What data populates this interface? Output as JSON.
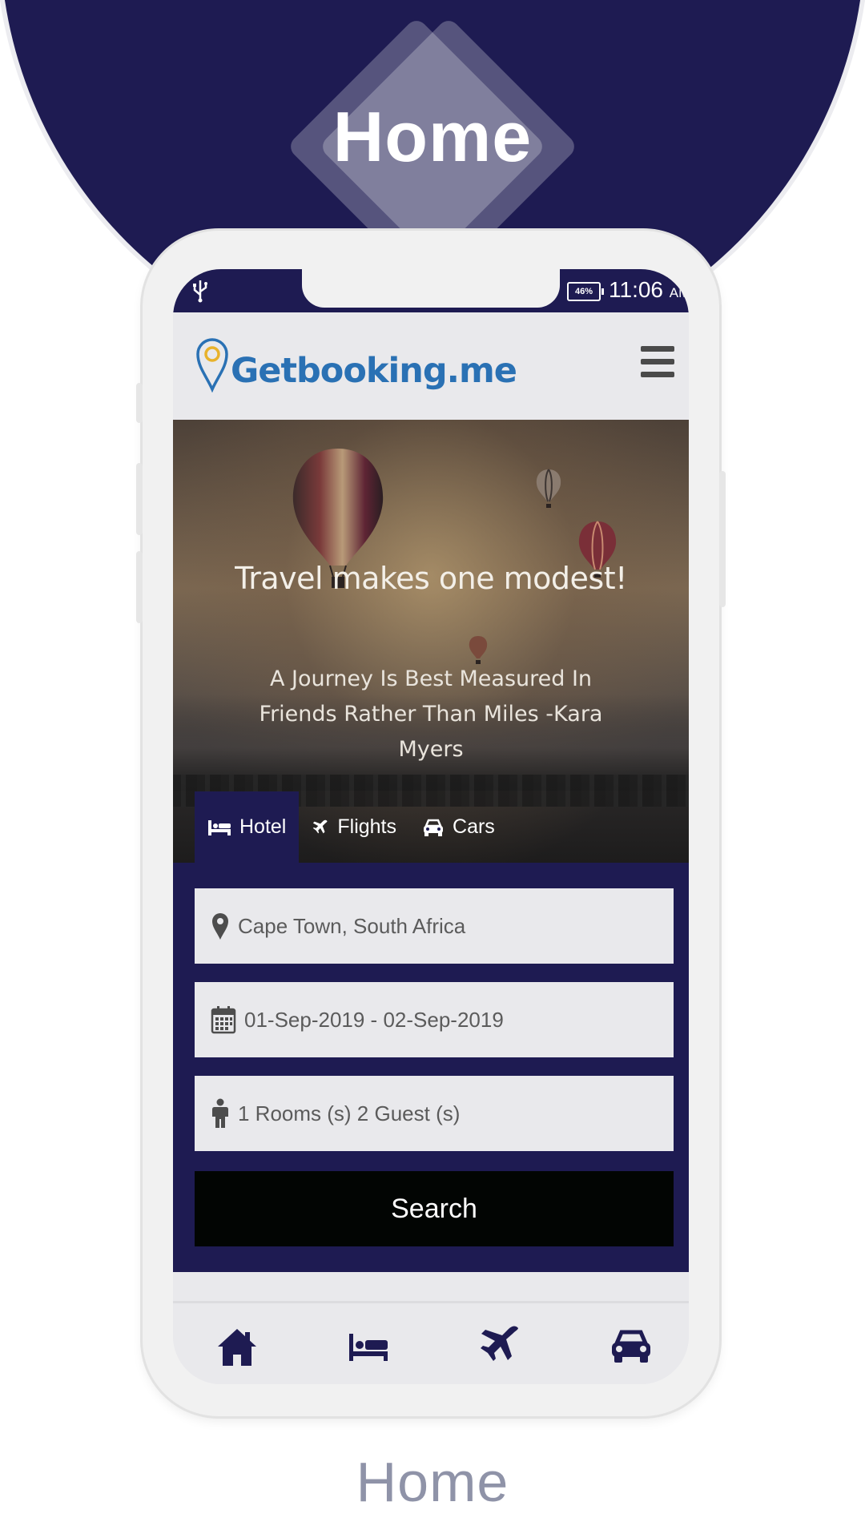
{
  "page": {
    "top_title": "Home",
    "bottom_title": "Home"
  },
  "status_bar": {
    "battery": "46%",
    "time": "11:06",
    "ampm": "AM"
  },
  "app": {
    "logo_text": "Getbooking.me"
  },
  "hero": {
    "title": "Travel makes one modest!",
    "quote": "A Journey Is Best Measured In Friends Rather Than Miles -Kara Myers"
  },
  "tabs": [
    {
      "label": "Hotel",
      "icon": "bed-icon",
      "active": true
    },
    {
      "label": "Flights",
      "icon": "plane-icon",
      "active": false
    },
    {
      "label": "Cars",
      "icon": "car-icon",
      "active": false
    }
  ],
  "form": {
    "location": "Cape Town, South Africa",
    "dates": "01-Sep-2019 - 02-Sep-2019",
    "guests": "1 Rooms (s) 2 Guest (s)",
    "search_label": "Search"
  },
  "bottom_nav": [
    "home-icon",
    "bed-icon",
    "plane-icon",
    "car-icon"
  ],
  "colors": {
    "navy": "#1e1b52",
    "logo_blue": "#2a71b4",
    "search_button": "#020503",
    "bottom_title": "#8f93a8"
  }
}
